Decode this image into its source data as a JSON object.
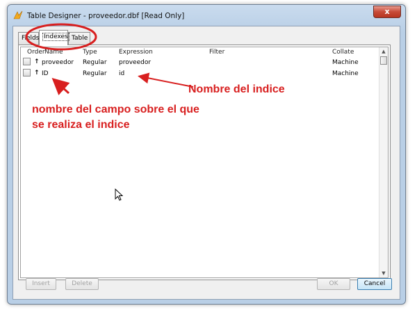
{
  "window": {
    "title": "Table Designer - proveedor.dbf [Read Only]",
    "close_label": "x"
  },
  "tabs": [
    {
      "label": "Fields",
      "active": false
    },
    {
      "label": "Indexes",
      "active": true
    },
    {
      "label": "Table",
      "active": false
    }
  ],
  "grid": {
    "columns": [
      "Order",
      "Name",
      "Type",
      "Expression",
      "Filter",
      "Collate"
    ],
    "rows": [
      {
        "order": "↑",
        "name": "proveedor",
        "type": "Regular",
        "expression": "proveedor",
        "filter": "",
        "collate": "Machine"
      },
      {
        "order": "↑",
        "name": "ID",
        "type": "Regular",
        "expression": "id",
        "filter": "",
        "collate": "Machine"
      }
    ]
  },
  "buttons": {
    "insert": "Insert",
    "delete": "Delete",
    "ok": "OK",
    "cancel": "Cancel"
  },
  "annotations": {
    "index_name": "Nombre del indice",
    "field_name_line1": "nombre del campo sobre el que",
    "field_name_line2": "se realiza el indice",
    "color": "#d81f1f"
  }
}
